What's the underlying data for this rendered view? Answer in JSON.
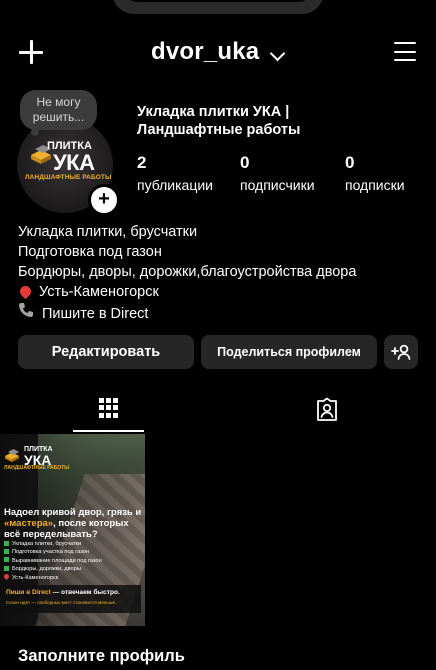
{
  "header": {
    "username": "dvor_uka"
  },
  "profile": {
    "note": "Не могу решить...",
    "full_name_line1": "Укладка плитки УКА |",
    "full_name_line2": "Ландшафтные работы",
    "avatar_logo_top": "ПЛИТКА",
    "avatar_logo_main": "УКА",
    "avatar_logo_sub": "ЛАНДШАФТНЫЕ РАБОТЫ",
    "add_story_symbol": "+"
  },
  "stats": [
    {
      "value": "2",
      "label": "публикации"
    },
    {
      "value": "0",
      "label": "подписчики"
    },
    {
      "value": "0",
      "label": "подписки"
    }
  ],
  "bio": {
    "lines": [
      "Укладка плитки, брусчатки",
      "Подготовка под газон",
      "Бордюры, дворы, дорожки,благоустройства двора"
    ],
    "location": "Усть-Каменогорск",
    "contact": "Пишите в Direct"
  },
  "actions": {
    "edit": "Редактировать",
    "share": "Поделиться профилем"
  },
  "icons": {
    "create": "plus-icon",
    "menu": "hamburger-menu-icon",
    "dropdown": "chevron-down-icon",
    "add_person": "add-person-icon",
    "grid": "grid-icon",
    "tagged": "tagged-person-icon",
    "location": "location-pin-icon",
    "phone": "phone-icon"
  },
  "post": {
    "brand_top": "ПЛИТКА",
    "brand_main": "УКА",
    "brand_sub": "ЛАНДШАФТНЫЕ РАБОТЫ",
    "headline_part1": "Надоел кривой двор, грязь и ",
    "headline_highlight": "«мастера»",
    "headline_part2": ", после которых всё переделывать?",
    "checklist": [
      "Укладка плитки, брусчатки",
      "Подготовка участка под газон",
      "Выравнивание площади под газон",
      "Бордюры, дорожки, дворы"
    ],
    "location": "Усть-Каменогорск",
    "cta_part1": "Пиши в Direct",
    "cta_part2": " — отвечаем быстро.",
    "cta_note": "Сезон идёт — свободных мест становится меньше."
  },
  "footer": {
    "complete_profile": "Заполните профиль"
  },
  "colors": {
    "background": "#000000",
    "button": "#262626",
    "accent": "#f0b12c",
    "check": "#37b24d",
    "pin": "#e53935"
  }
}
